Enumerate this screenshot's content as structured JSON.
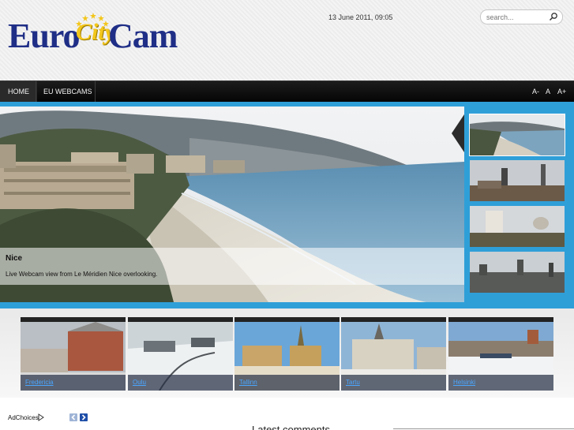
{
  "header": {
    "logo": {
      "word1": "Euro",
      "word2": "City",
      "word3": "Cam"
    },
    "datetime": "13 June 2011, 09:05",
    "search": {
      "placeholder": "search...",
      "icon": "search-icon"
    }
  },
  "nav": {
    "items": [
      {
        "label": "HOME"
      },
      {
        "label": "EU WEBCAMS"
      }
    ],
    "font_sizes": [
      {
        "label": "A-"
      },
      {
        "label": "A"
      },
      {
        "label": "A+"
      }
    ]
  },
  "hero": {
    "title": "Nice",
    "description": "Live Webcam view from Le Méridien Nice overlooking.",
    "accent_color": "#2f9fd8"
  },
  "cams": [
    {
      "label": "Fredericia"
    },
    {
      "label": "Oulu"
    },
    {
      "label": "Tallinn"
    },
    {
      "label": "Tartu"
    },
    {
      "label": "Helsinki"
    }
  ],
  "footer": {
    "adchoices": "AdChoices",
    "latest_heading": "Latest comments"
  }
}
